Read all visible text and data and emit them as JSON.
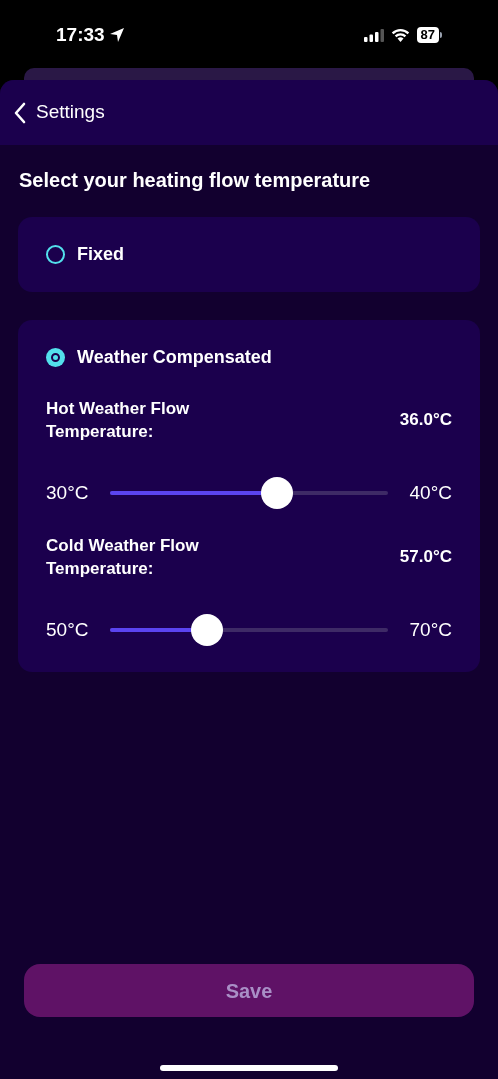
{
  "status_bar": {
    "time": "17:33",
    "battery": "87"
  },
  "header": {
    "back_label": "Settings"
  },
  "title": "Select your heating flow temperature",
  "options": [
    {
      "label": "Fixed",
      "selected": false
    },
    {
      "label": "Weather Compensated",
      "selected": true,
      "settings": [
        {
          "label": "Hot Weather Flow Temperature:",
          "value": "36.0°C",
          "min": "30°C",
          "max": "40°C",
          "level": 0.6
        },
        {
          "label": "Cold Weather Flow Temperature:",
          "value": "57.0°C",
          "min": "50°C",
          "max": "70°C",
          "level": 0.35
        }
      ]
    }
  ],
  "save_button": {
    "label": "Save",
    "disabled": true
  }
}
